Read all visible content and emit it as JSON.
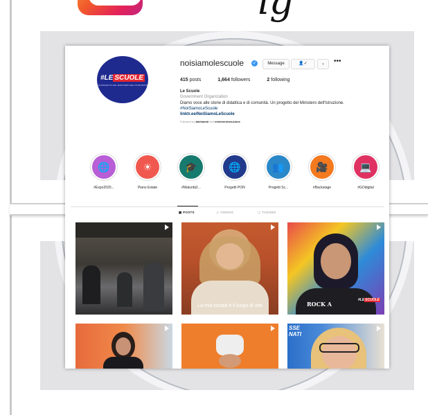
{
  "page": {
    "logo_word": "ig",
    "logo_icon": "instagram-logo-icon"
  },
  "profile": {
    "avatar_text": "#LE",
    "avatar_text_hl": "SCUOLE",
    "avatar_sub": "UN PROGETTO DEL MINISTERO DELL'ISTRUZIONE",
    "username": "noisiamolescuole",
    "verified_glyph": "✓",
    "message_label": "Message",
    "follow_glyph": "👤✓",
    "chevron_glyph": "⌄",
    "more_glyph": "•••",
    "posts_count": "415",
    "posts_label": "posts",
    "followers_count": "1,664",
    "followers_label": "followers",
    "following_count": "2",
    "following_label": "following",
    "name": "Le Scuole",
    "category": "Government Organization",
    "bio": "Diamo voce alle storie di didattica e di comunità. Un progetto del Ministero dell'Istruzione.",
    "hashtag": "#NoiSiamoLeScuole",
    "link": "linktr.ee/NoiSiamoLeScuole",
    "followed_prefix": "Followed by",
    "followed_a": "talebambi",
    "followed_and": "and",
    "followed_b": "ministeroistruzione"
  },
  "highlights": [
    {
      "label": "#Expo2020...",
      "color": "#b85ed6",
      "icon": "globe-icon",
      "glyph": "🌐"
    },
    {
      "label": "Piano Estate",
      "color": "#f0584f",
      "icon": "sun-icon",
      "glyph": "☀"
    },
    {
      "label": "#Maturità2...",
      "color": "#177a6e",
      "icon": "graduation-cap-icon",
      "glyph": "🎓"
    },
    {
      "label": "Progetti PON",
      "color": "#223a8c",
      "icon": "globe-network-icon",
      "glyph": "🌐"
    },
    {
      "label": "Progetti Sc...",
      "color": "#2a88c9",
      "icon": "people-icon",
      "glyph": "👥"
    },
    {
      "label": "#Backstage",
      "color": "#f4791f",
      "icon": "video-camera-icon",
      "glyph": "🎥"
    },
    {
      "label": "#GOdigital",
      "color": "#e03262",
      "icon": "laptop-icon",
      "glyph": "💻"
    }
  ],
  "tabs": [
    {
      "label": "▦ POSTS",
      "active": true
    },
    {
      "label": "▷ VIDEOS",
      "active": false
    },
    {
      "label": "▢ TAGGED",
      "active": false
    }
  ],
  "posts": [
    {
      "caption": "",
      "overlay": ""
    },
    {
      "caption": "La mia scuola è il luogo di vita",
      "overlay": ""
    },
    {
      "caption": "",
      "overlay": "",
      "jersey": "ROCK A",
      "badge_a": "#LE",
      "badge_b": "SCUOLE"
    },
    {
      "caption": "",
      "overlay": ""
    },
    {
      "caption": "",
      "overlay": ""
    },
    {
      "caption": "",
      "overlay": "SSE\nNATI"
    }
  ],
  "colors": {
    "accent": "#3897f0",
    "brand_blue": "#1f2a8f",
    "brand_red": "#e5262f"
  }
}
